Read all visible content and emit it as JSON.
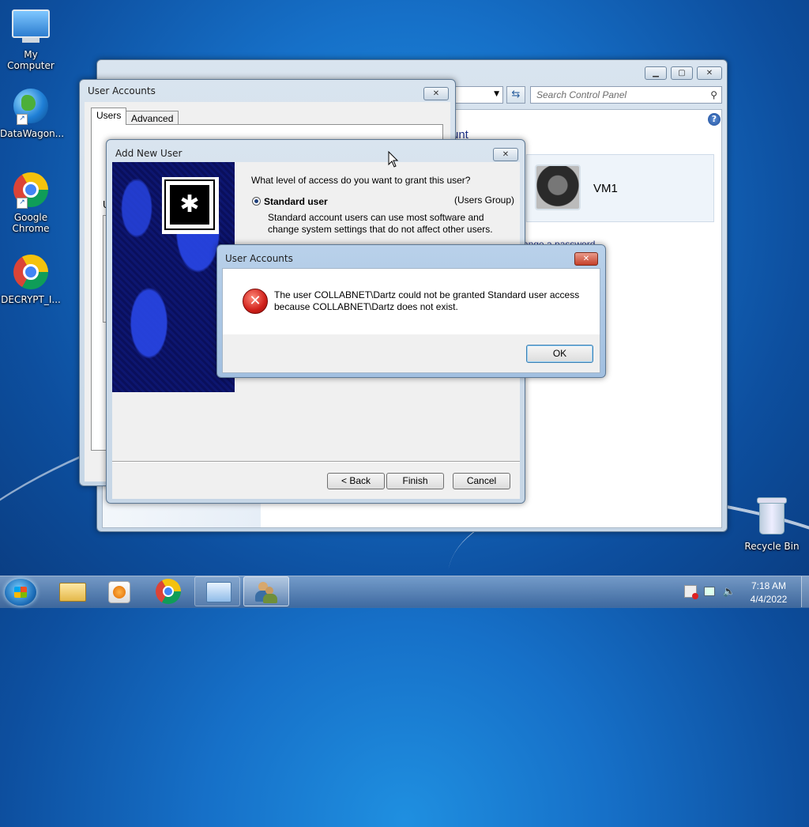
{
  "desktop": {
    "icons": [
      {
        "label": "My Computer"
      },
      {
        "label": "DataWagon..."
      },
      {
        "label": "Google Chrome"
      },
      {
        "label": "DECRYPT_I..."
      },
      {
        "label": "Recycle Bin"
      }
    ]
  },
  "control_panel": {
    "search_placeholder": "Search Control Panel",
    "heading_fragment": "unt",
    "user_name": "VM1",
    "link_fragment": "ange a password"
  },
  "user_accounts_window": {
    "title": "User Accounts",
    "tabs": [
      {
        "label": "Users"
      },
      {
        "label": "Advanced"
      }
    ],
    "row_fragment": "U"
  },
  "add_user_wizard": {
    "title": "Add New User",
    "question": "What level of access do you want to grant this user?",
    "option_label": "Standard user",
    "option_group": "(Users Group)",
    "option_description": "Standard account users can use most software and change system settings that do not affect other users.",
    "buttons": {
      "back": "< Back",
      "finish": "Finish",
      "cancel": "Cancel"
    }
  },
  "error_dialog": {
    "title": "User Accounts",
    "message": "The user COLLABNET\\Dartz could not be granted Standard user access because COLLABNET\\Dartz does not exist.",
    "ok_label": "OK",
    "close_glyph": "✕"
  },
  "taskbar": {
    "time": "7:18 AM",
    "date": "4/4/2022"
  }
}
